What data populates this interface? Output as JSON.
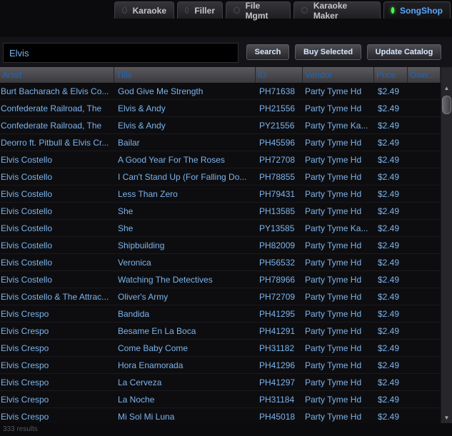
{
  "tabs": [
    {
      "label": "Karaoke",
      "active": false
    },
    {
      "label": "Filler",
      "active": false
    },
    {
      "label": "File Mgmt",
      "active": false
    },
    {
      "label": "Karaoke Maker",
      "active": false
    },
    {
      "label": "SongShop",
      "active": true
    }
  ],
  "search": {
    "value": "Elvis",
    "button": "Search"
  },
  "actions": {
    "buy_selected": "Buy Selected",
    "update_catalog": "Update Catalog"
  },
  "columns": {
    "artist": "Artist",
    "title": "Title",
    "id": "ID",
    "vendor": "Vendor",
    "price": "Price",
    "own": "Own..."
  },
  "rows": [
    {
      "artist": "Burt Bacharach & Elvis Co...",
      "title": "God Give Me Strength",
      "id": "PH71638",
      "vendor": "Party Tyme Hd",
      "price": "$2.49"
    },
    {
      "artist": "Confederate Railroad, The",
      "title": "Elvis & Andy",
      "id": "PH21556",
      "vendor": "Party Tyme Hd",
      "price": "$2.49"
    },
    {
      "artist": "Confederate Railroad, The",
      "title": "Elvis & Andy",
      "id": "PY21556",
      "vendor": "Party Tyme Ka...",
      "price": "$2.49"
    },
    {
      "artist": "Deorro ft. Pitbull & Elvis Cr...",
      "title": "Bailar",
      "id": "PH45596",
      "vendor": "Party Tyme Hd",
      "price": "$2.49"
    },
    {
      "artist": "Elvis Costello",
      "title": "A Good Year For The Roses",
      "id": "PH72708",
      "vendor": "Party Tyme Hd",
      "price": "$2.49"
    },
    {
      "artist": "Elvis Costello",
      "title": "I Can't Stand Up (For Falling Do...",
      "id": "PH78855",
      "vendor": "Party Tyme Hd",
      "price": "$2.49"
    },
    {
      "artist": "Elvis Costello",
      "title": "Less Than Zero",
      "id": "PH79431",
      "vendor": "Party Tyme Hd",
      "price": "$2.49"
    },
    {
      "artist": "Elvis Costello",
      "title": "She",
      "id": "PH13585",
      "vendor": "Party Tyme Hd",
      "price": "$2.49"
    },
    {
      "artist": "Elvis Costello",
      "title": "She",
      "id": "PY13585",
      "vendor": "Party Tyme Ka...",
      "price": "$2.49"
    },
    {
      "artist": "Elvis Costello",
      "title": "Shipbuilding",
      "id": "PH82009",
      "vendor": "Party Tyme Hd",
      "price": "$2.49"
    },
    {
      "artist": "Elvis Costello",
      "title": "Veronica",
      "id": "PH56532",
      "vendor": "Party Tyme Hd",
      "price": "$2.49"
    },
    {
      "artist": "Elvis Costello",
      "title": "Watching The Detectives",
      "id": "PH78966",
      "vendor": "Party Tyme Hd",
      "price": "$2.49"
    },
    {
      "artist": "Elvis Costello & The Attrac...",
      "title": "Oliver's Army",
      "id": "PH72709",
      "vendor": "Party Tyme Hd",
      "price": "$2.49"
    },
    {
      "artist": "Elvis Crespo",
      "title": "Bandida",
      "id": "PH41295",
      "vendor": "Party Tyme Hd",
      "price": "$2.49"
    },
    {
      "artist": "Elvis Crespo",
      "title": "Besame En La Boca",
      "id": "PH41291",
      "vendor": "Party Tyme Hd",
      "price": "$2.49"
    },
    {
      "artist": "Elvis Crespo",
      "title": "Come Baby Come",
      "id": "PH31182",
      "vendor": "Party Tyme Hd",
      "price": "$2.49"
    },
    {
      "artist": "Elvis Crespo",
      "title": "Hora Enamorada",
      "id": "PH41296",
      "vendor": "Party Tyme Hd",
      "price": "$2.49"
    },
    {
      "artist": "Elvis Crespo",
      "title": "La Cerveza",
      "id": "PH41297",
      "vendor": "Party Tyme Hd",
      "price": "$2.49"
    },
    {
      "artist": "Elvis Crespo",
      "title": "La Noche",
      "id": "PH31184",
      "vendor": "Party Tyme Hd",
      "price": "$2.49"
    },
    {
      "artist": "Elvis Crespo",
      "title": "Mi Sol Mi Luna",
      "id": "PH45018",
      "vendor": "Party Tyme Hd",
      "price": "$2.49"
    }
  ],
  "status": {
    "results": "333 results"
  },
  "colors": {
    "background": "#0d0d10",
    "text": "#7cb4ec",
    "header_text": "#1c66c2",
    "active_tab": "#5aa8ff",
    "active_dot": "#3cff3c"
  }
}
